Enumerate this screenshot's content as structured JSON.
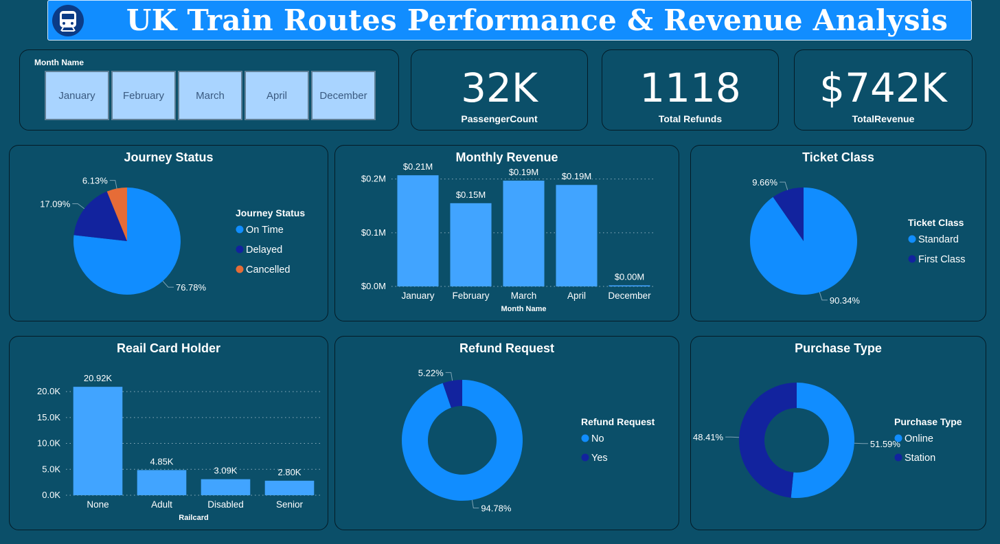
{
  "header": {
    "title": "UK Train Routes Performance & Revenue Analysis",
    "logo_icon": "train-icon"
  },
  "slicer": {
    "label": "Month Name",
    "options": [
      "January",
      "February",
      "March",
      "April",
      "December"
    ]
  },
  "kpis": [
    {
      "value": "32K",
      "label": "PassengerCount"
    },
    {
      "value": "1118",
      "label": "Total Refunds"
    },
    {
      "value": "$742K",
      "label": "TotalRevenue"
    }
  ],
  "colors": {
    "background": "#0b4f69",
    "header": "#118dff",
    "light_blue": "#118dff",
    "bar_blue": "#41a4ff",
    "dark_blue": "#12239e",
    "orange": "#e66c37",
    "slicer": "#a9d4ff"
  },
  "chart_data": [
    {
      "type": "pie",
      "title": "Journey Status",
      "legend_title": "Journey Status",
      "legend_position": "right",
      "slices": [
        {
          "name": "On Time",
          "value": 76.78,
          "label": "76.78%",
          "color": "#118dff"
        },
        {
          "name": "Delayed",
          "value": 17.09,
          "label": "17.09%",
          "color": "#12239e"
        },
        {
          "name": "Cancelled",
          "value": 6.13,
          "label": "6.13%",
          "color": "#e66c37"
        }
      ]
    },
    {
      "type": "bar",
      "title": "Monthly Revenue",
      "xlabel": "Month Name",
      "ylabel": "",
      "categories": [
        "January",
        "February",
        "March",
        "April",
        "December"
      ],
      "values": [
        0.207,
        0.155,
        0.197,
        0.189,
        0.002
      ],
      "data_labels": [
        "$0.21M",
        "$0.15M",
        "$0.19M",
        "$0.19M",
        "$0.00M"
      ],
      "yticks": [
        "$0.0M",
        "$0.1M",
        "$0.2M"
      ],
      "ytick_values": [
        0,
        0.1,
        0.2
      ],
      "ylim": [
        0,
        0.22
      ],
      "grid": true
    },
    {
      "type": "pie",
      "title": "Ticket Class",
      "legend_title": "Ticket Class",
      "legend_position": "right",
      "slices": [
        {
          "name": "Standard",
          "value": 90.34,
          "label": "90.34%",
          "color": "#118dff"
        },
        {
          "name": "First Class",
          "value": 9.66,
          "label": "9.66%",
          "color": "#12239e"
        }
      ]
    },
    {
      "type": "bar",
      "title": "Reail Card Holder",
      "xlabel": "Railcard",
      "ylabel": "",
      "categories": [
        "None",
        "Adult",
        "Disabled",
        "Senior"
      ],
      "values": [
        20920,
        4850,
        3090,
        2800
      ],
      "data_labels": [
        "20.92K",
        "4.85K",
        "3.09K",
        "2.80K"
      ],
      "yticks": [
        "0.0K",
        "5.0K",
        "10.0K",
        "15.0K",
        "20.0K"
      ],
      "ytick_values": [
        0,
        5000,
        10000,
        15000,
        20000
      ],
      "ylim": [
        0,
        22000
      ],
      "grid": true
    },
    {
      "type": "pie",
      "donut": true,
      "title": "Refund Request",
      "legend_title": "Refund Request",
      "legend_position": "right",
      "slices": [
        {
          "name": "No",
          "value": 94.78,
          "label": "94.78%",
          "color": "#118dff"
        },
        {
          "name": "Yes",
          "value": 5.22,
          "label": "5.22%",
          "color": "#12239e"
        }
      ]
    },
    {
      "type": "pie",
      "donut": true,
      "title": "Purchase Type",
      "legend_title": "Purchase Type",
      "legend_position": "right",
      "slices": [
        {
          "name": "Online",
          "value": 51.59,
          "label": "51.59%",
          "color": "#118dff"
        },
        {
          "name": "Station",
          "value": 48.41,
          "label": "48.41%",
          "color": "#12239e"
        }
      ]
    }
  ]
}
